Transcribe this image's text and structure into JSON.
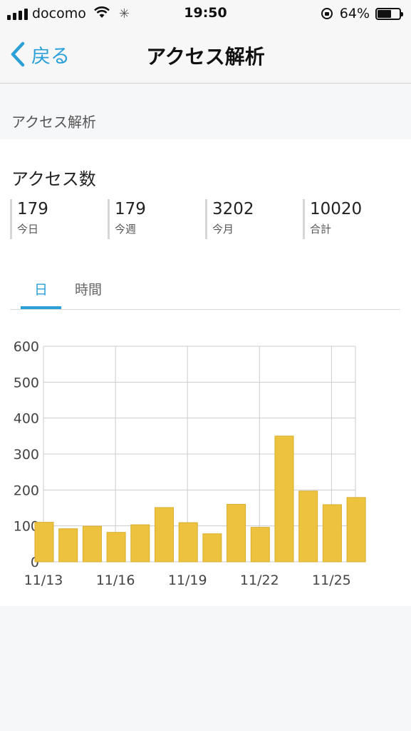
{
  "status_bar": {
    "carrier": "docomo",
    "time": "19:50",
    "battery": "64%",
    "battery_level": 0.64,
    "icons": [
      "signal-icon",
      "wifi-icon",
      "activity-spinner-icon",
      "rotation-lock-icon",
      "battery-icon"
    ]
  },
  "nav": {
    "back_label": "戻る",
    "title": "アクセス解析"
  },
  "section": {
    "header": "アクセス解析"
  },
  "access": {
    "title": "アクセス数",
    "stats": [
      {
        "value": "179",
        "label": "今日"
      },
      {
        "value": "179",
        "label": "今週"
      },
      {
        "value": "3202",
        "label": "今月"
      },
      {
        "value": "10020",
        "label": "合計"
      }
    ]
  },
  "tabs": [
    {
      "label": "日",
      "active": true
    },
    {
      "label": "時間",
      "active": false
    }
  ],
  "colors": {
    "accent": "#2a9fd8",
    "bar": "#ecc23f",
    "bar_stroke": "#d9ad2a",
    "grid": "#cccccc"
  },
  "chart_data": {
    "type": "bar",
    "categories": [
      "11/13",
      "11/14",
      "11/15",
      "11/16",
      "11/17",
      "11/18",
      "11/19",
      "11/20",
      "11/21",
      "11/22",
      "11/23",
      "11/24",
      "11/25",
      "11/26"
    ],
    "values": [
      110,
      92,
      99,
      82,
      103,
      151,
      109,
      78,
      160,
      96,
      350,
      197,
      159,
      179
    ],
    "x_tick_labels": [
      "11/13",
      "11/16",
      "11/19",
      "11/22",
      "11/25"
    ],
    "y_ticks": [
      0,
      100,
      200,
      300,
      400,
      500,
      600
    ],
    "ylim": [
      0,
      600
    ],
    "grid": true,
    "legend": "none"
  }
}
